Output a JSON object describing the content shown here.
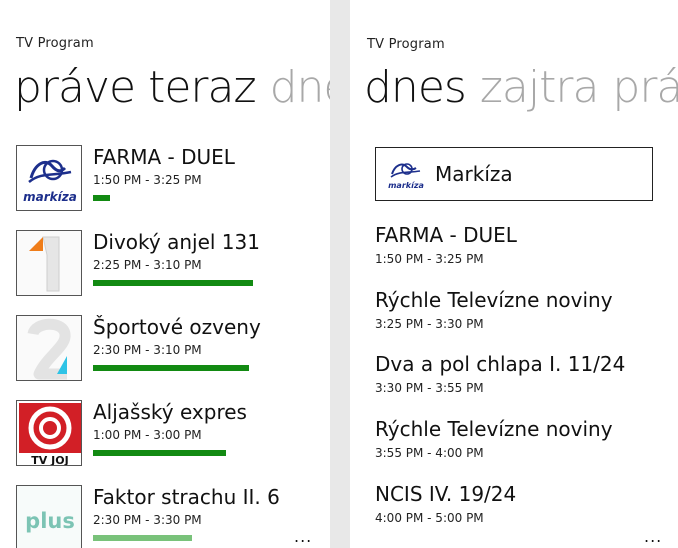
{
  "left_screen": {
    "app_title": "TV Program",
    "pivot": {
      "active": "práve teraz",
      "next_partial": "dne"
    },
    "now_playing": [
      {
        "channel_logo": "markiza-logo",
        "logo_text": "markíza",
        "title": "FARMA - DUEL",
        "time": "1:50 PM - 3:25 PM",
        "progress": 0.09
      },
      {
        "channel_logo": "jednotka-logo",
        "title": "Divoký anjel 131",
        "time": "2:25 PM - 3:10 PM",
        "progress": 0.84
      },
      {
        "channel_logo": "dvojka-logo",
        "title": "Športové ozveny",
        "time": "2:30 PM - 3:10 PM",
        "progress": 0.82
      },
      {
        "channel_logo": "tv-joj-logo",
        "logo_text": "TV JOJ",
        "title": "Aljašský expres",
        "time": "1:00 PM - 3:00 PM",
        "progress": 0.7
      },
      {
        "channel_logo": "plus-logo",
        "logo_text": "plus",
        "title": "Faktor strachu II. 6",
        "time": "2:30 PM - 3:30 PM",
        "progress": 0.52
      }
    ],
    "more_label": "..."
  },
  "right_screen": {
    "app_title": "TV Program",
    "pivot": {
      "active": "dnes",
      "next": "zajtra",
      "next_partial": "prá"
    },
    "channel": {
      "name": "Markíza",
      "logo_text": "markíza"
    },
    "schedule": [
      {
        "title": "FARMA - DUEL",
        "time": "1:50 PM - 3:25 PM"
      },
      {
        "title": "Rýchle Televízne noviny",
        "time": "3:25 PM - 3:30 PM"
      },
      {
        "title": "Dva a pol chlapa I. 11/24",
        "time": "3:30 PM - 3:55 PM"
      },
      {
        "title": "Rýchle Televízne noviny",
        "time": "3:55 PM - 4:00 PM"
      },
      {
        "title": "NCIS IV. 19/24",
        "time": "4:00 PM - 5:00 PM"
      }
    ],
    "more_label": "..."
  },
  "colors": {
    "progress_active": "#128a12",
    "progress_dim": "#79c27a",
    "pivot_inactive": "#a8a8a8",
    "markiza_blue": "#1d2f8c",
    "joj_red": "#d21f26",
    "plus_green": "#7cc4b4",
    "jednotka_orange": "#ef7d1a",
    "dvojka_cyan": "#2ec3e6"
  }
}
